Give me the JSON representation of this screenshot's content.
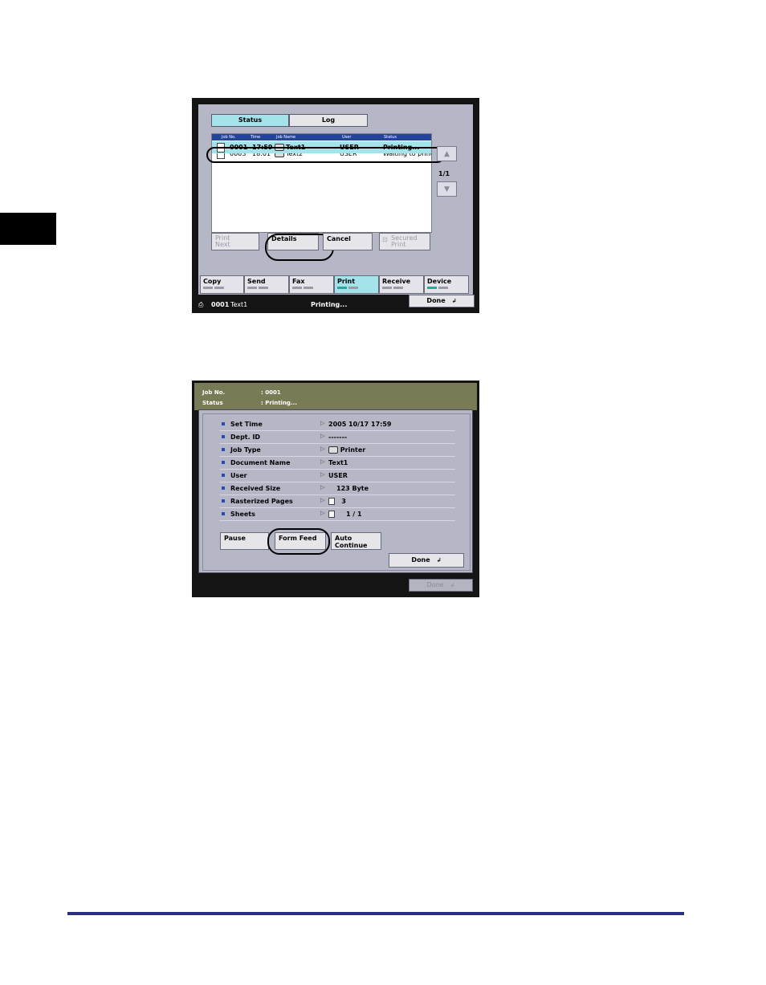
{
  "screen1": {
    "tabs": {
      "status": "Status",
      "log": "Log"
    },
    "columns": {
      "job_no": "Job No.",
      "time": "Time",
      "job_name": "Job Name",
      "user": "User",
      "status": "Status"
    },
    "rows": [
      {
        "job_no": "0001",
        "time": "17:59",
        "job_name": "Text1",
        "user": "USER",
        "status": "Printing..."
      },
      {
        "job_no": "0003",
        "time": "18:01",
        "job_name": "Text2",
        "user": "USER",
        "status": "Waiting to print"
      }
    ],
    "page_indicator": "1/1",
    "scroll_up": "▲",
    "scroll_down": "▼",
    "buttons": {
      "print_next_line1": "Print",
      "print_next_line2": "Next",
      "details": "Details",
      "cancel": "Cancel",
      "secured_line1": "Secured",
      "secured_line2": "Print"
    },
    "functions": [
      "Copy",
      "Send",
      "Fax",
      "Print",
      "Receive",
      "Device"
    ],
    "status_bar": {
      "job_no": "0001",
      "job_name": "Text1",
      "message": "Printing..."
    },
    "done": "Done"
  },
  "screen2": {
    "header": {
      "job_no_label": "Job No.",
      "job_no_value": ": 0001",
      "status_label": "Status",
      "status_value": ": Printing..."
    },
    "details": [
      {
        "label": "Set Time",
        "value": "2005 10/17  17:59"
      },
      {
        "label": "Dept. ID",
        "value": "-------"
      },
      {
        "label": "Job Type",
        "value": "Printer"
      },
      {
        "label": "Document Name",
        "value": "Text1"
      },
      {
        "label": "User",
        "value": "USER"
      },
      {
        "label": "Received Size",
        "value": "123  Byte"
      },
      {
        "label": "Rasterized Pages",
        "value": "3"
      },
      {
        "label": "Sheets",
        "value": "1  /   1"
      }
    ],
    "buttons": {
      "pause": "Pause",
      "form_feed": "Form Feed",
      "auto_line1": "Auto",
      "auto_line2": "Continue"
    },
    "done": "Done",
    "done_inactive": "Done"
  }
}
